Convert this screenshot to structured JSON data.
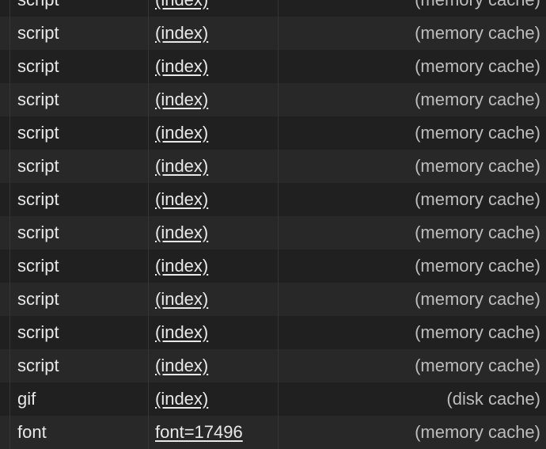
{
  "network_table": {
    "rows": [
      {
        "type": "script",
        "initiator": "(index)",
        "size": "(memory cache)"
      },
      {
        "type": "script",
        "initiator": "(index)",
        "size": "(memory cache)"
      },
      {
        "type": "script",
        "initiator": "(index)",
        "size": "(memory cache)"
      },
      {
        "type": "script",
        "initiator": "(index)",
        "size": "(memory cache)"
      },
      {
        "type": "script",
        "initiator": "(index)",
        "size": "(memory cache)"
      },
      {
        "type": "script",
        "initiator": "(index)",
        "size": "(memory cache)"
      },
      {
        "type": "script",
        "initiator": "(index)",
        "size": "(memory cache)"
      },
      {
        "type": "script",
        "initiator": "(index)",
        "size": "(memory cache)"
      },
      {
        "type": "script",
        "initiator": "(index)",
        "size": "(memory cache)"
      },
      {
        "type": "script",
        "initiator": "(index)",
        "size": "(memory cache)"
      },
      {
        "type": "script",
        "initiator": "(index)",
        "size": "(memory cache)"
      },
      {
        "type": "script",
        "initiator": "(index)",
        "size": "(memory cache)"
      },
      {
        "type": "gif",
        "initiator": "(index)",
        "size": "(disk cache)"
      },
      {
        "type": "font",
        "initiator": "font=17496",
        "size": "(memory cache)"
      }
    ]
  },
  "colors": {
    "background_odd": "#202020",
    "background_even": "#282828",
    "text": "#e8e8e8",
    "size_text": "#bdbdbd",
    "divider": "#353535"
  }
}
